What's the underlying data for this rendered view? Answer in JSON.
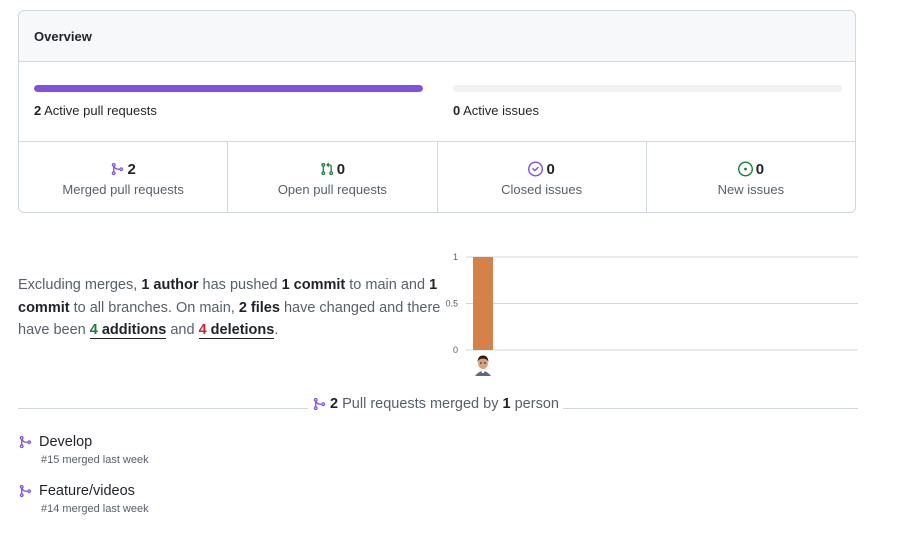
{
  "overview": {
    "title": "Overview",
    "active_prs": {
      "count": "2",
      "label": "Active pull requests",
      "progress_fraction": 1.0
    },
    "active_issues": {
      "count": "0",
      "label": "Active issues",
      "progress_fraction": 0.0
    },
    "stats": [
      {
        "id": "merged",
        "icon": "git-merge-icon",
        "count": "2",
        "label": "Merged pull requests",
        "color": "#8250df"
      },
      {
        "id": "open",
        "icon": "git-pull-request-icon",
        "count": "0",
        "label": "Open pull requests",
        "color": "#1a7f37"
      },
      {
        "id": "closed",
        "icon": "issue-closed-icon",
        "count": "0",
        "label": "Closed issues",
        "color": "#8250df"
      },
      {
        "id": "new",
        "icon": "issue-opened-icon",
        "count": "0",
        "label": "New issues",
        "color": "#1a7f37"
      }
    ]
  },
  "summary": {
    "p1": "Excluding merges, ",
    "authors": "1 author",
    "p2": " has pushed ",
    "commits_main": "1 commit",
    "p3": " to main and ",
    "commits_all": "1 commit",
    "p4": " to all branches. On main, ",
    "files": "2 files",
    "p5": " have changed and there have been ",
    "additions_num": "4",
    "additions_word": " additions",
    "p6": " and ",
    "deletions_num": "4",
    "deletions_word": " deletions",
    "p7": "."
  },
  "chart_data": {
    "type": "bar",
    "categories": [
      "contributor-1"
    ],
    "values": [
      1
    ],
    "ylim": [
      0,
      1
    ],
    "yticks": [
      "0",
      "0.5",
      "1"
    ],
    "bar_color": "#d4824a",
    "grid": true
  },
  "merged_divider": {
    "count": "2",
    "text1": " Pull requests merged by ",
    "people": "1",
    "text2": " person"
  },
  "merged_prs": [
    {
      "title": "Develop",
      "meta": "#15 merged last week"
    },
    {
      "title": "Feature/videos",
      "meta": "#14 merged last week"
    }
  ],
  "colors": {
    "accent_purple": "#8250df",
    "success_green": "#1a7f37",
    "danger_red": "#cf222e"
  }
}
